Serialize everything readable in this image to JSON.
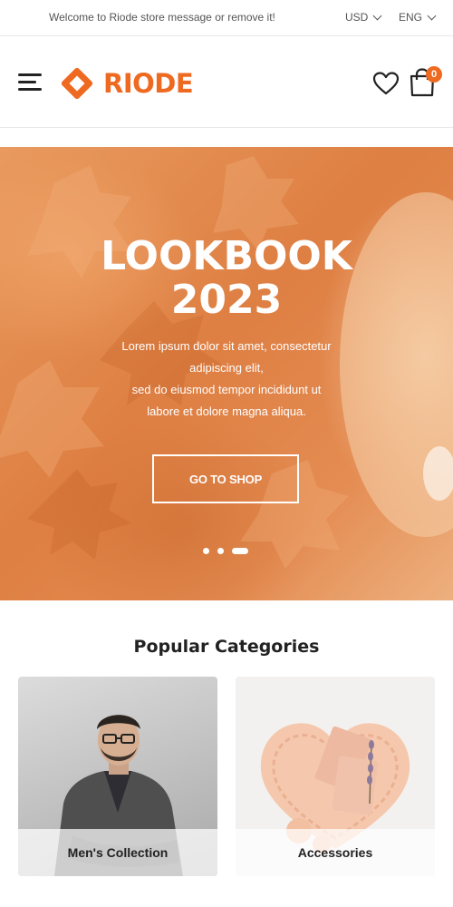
{
  "topbar": {
    "message": "Welcome to Riode store message or remove it!",
    "currency": "USD",
    "language": "ENG"
  },
  "header": {
    "logo_text": "RIODE",
    "cart_count": "0"
  },
  "hero": {
    "title_line1": "LOOKBOOK",
    "title_line2": "2023",
    "desc_lines": [
      "Lorem ipsum dolor sit amet, consectetur",
      "adipiscing elit,",
      "sed do eiusmod tempor incididunt ut",
      "labore et dolore magna aliqua."
    ],
    "cta_label": "GO TO SHOP",
    "slides": 3,
    "active_slide": 3
  },
  "categories": {
    "title": "Popular Categories",
    "items": [
      {
        "label": "Men's Collection"
      },
      {
        "label": "Accessories"
      }
    ]
  },
  "colors": {
    "accent": "#ef6a21",
    "text": "#222222"
  },
  "icons": [
    "menu-icon",
    "logo-icon",
    "heart-icon",
    "shopping-bag-icon",
    "chevron-down-icon"
  ]
}
